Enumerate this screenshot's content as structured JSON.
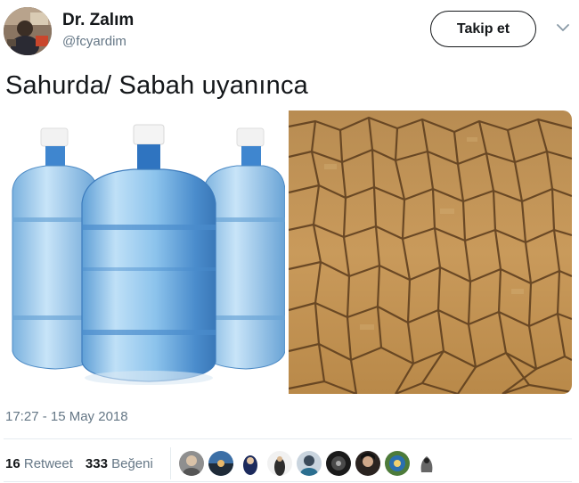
{
  "user": {
    "display_name": "Dr. Zalım",
    "handle": "@fcyardim",
    "avatar_icon": "profile-photo"
  },
  "actions": {
    "follow_label": "Takip et",
    "more_icon": "chevron-down-icon"
  },
  "tweet": {
    "text": "Sahurda/ Sabah uyanınca",
    "media": [
      {
        "description_icon": "water-bottles-image"
      },
      {
        "description_icon": "cracked-dry-earth-image"
      }
    ],
    "timestamp": "17:27 - 15 May 2018"
  },
  "stats": {
    "retweets_count": "16",
    "retweets_label": "Retweet",
    "likes_count": "333",
    "likes_label": "Beğeni"
  },
  "colors": {
    "text": "#14171a",
    "secondary": "#657786",
    "divider": "#e6ecf0"
  }
}
